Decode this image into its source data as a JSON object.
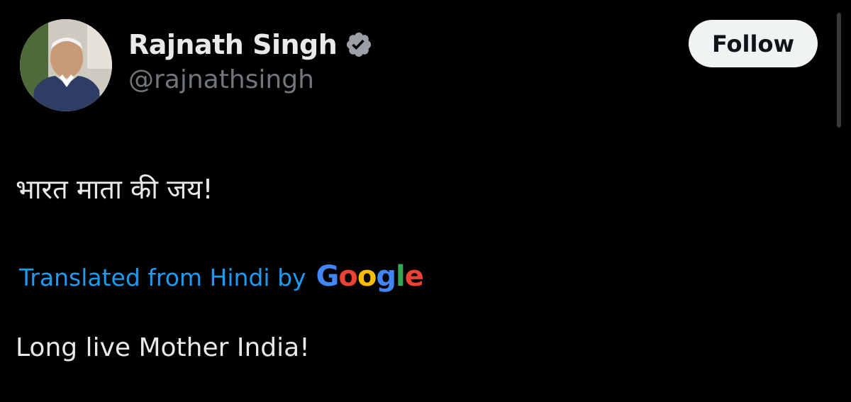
{
  "author": {
    "display_name": "Rajnath Singh",
    "handle": "@rajnathsingh",
    "verified": true,
    "verified_badge_color": "#1d9bf0"
  },
  "actions": {
    "follow_label": "Follow"
  },
  "tweet": {
    "original_text": "भारत माता की जय!",
    "translation_label": "Translated from Hindi by",
    "translation_provider": "Google",
    "translated_text": "Long live Mother India!"
  },
  "icons": {
    "avatar": "profile-photo",
    "verified": "verified-badge-icon"
  },
  "colors": {
    "background": "#000000",
    "primary_text": "#e7e9ea",
    "secondary_text": "#71767b",
    "link_blue": "#1d9bf0",
    "follow_bg": "#eff3f4",
    "google_blue": "#4285F4",
    "google_red": "#EA4335",
    "google_yellow": "#FBBC05",
    "google_green": "#34A853"
  }
}
